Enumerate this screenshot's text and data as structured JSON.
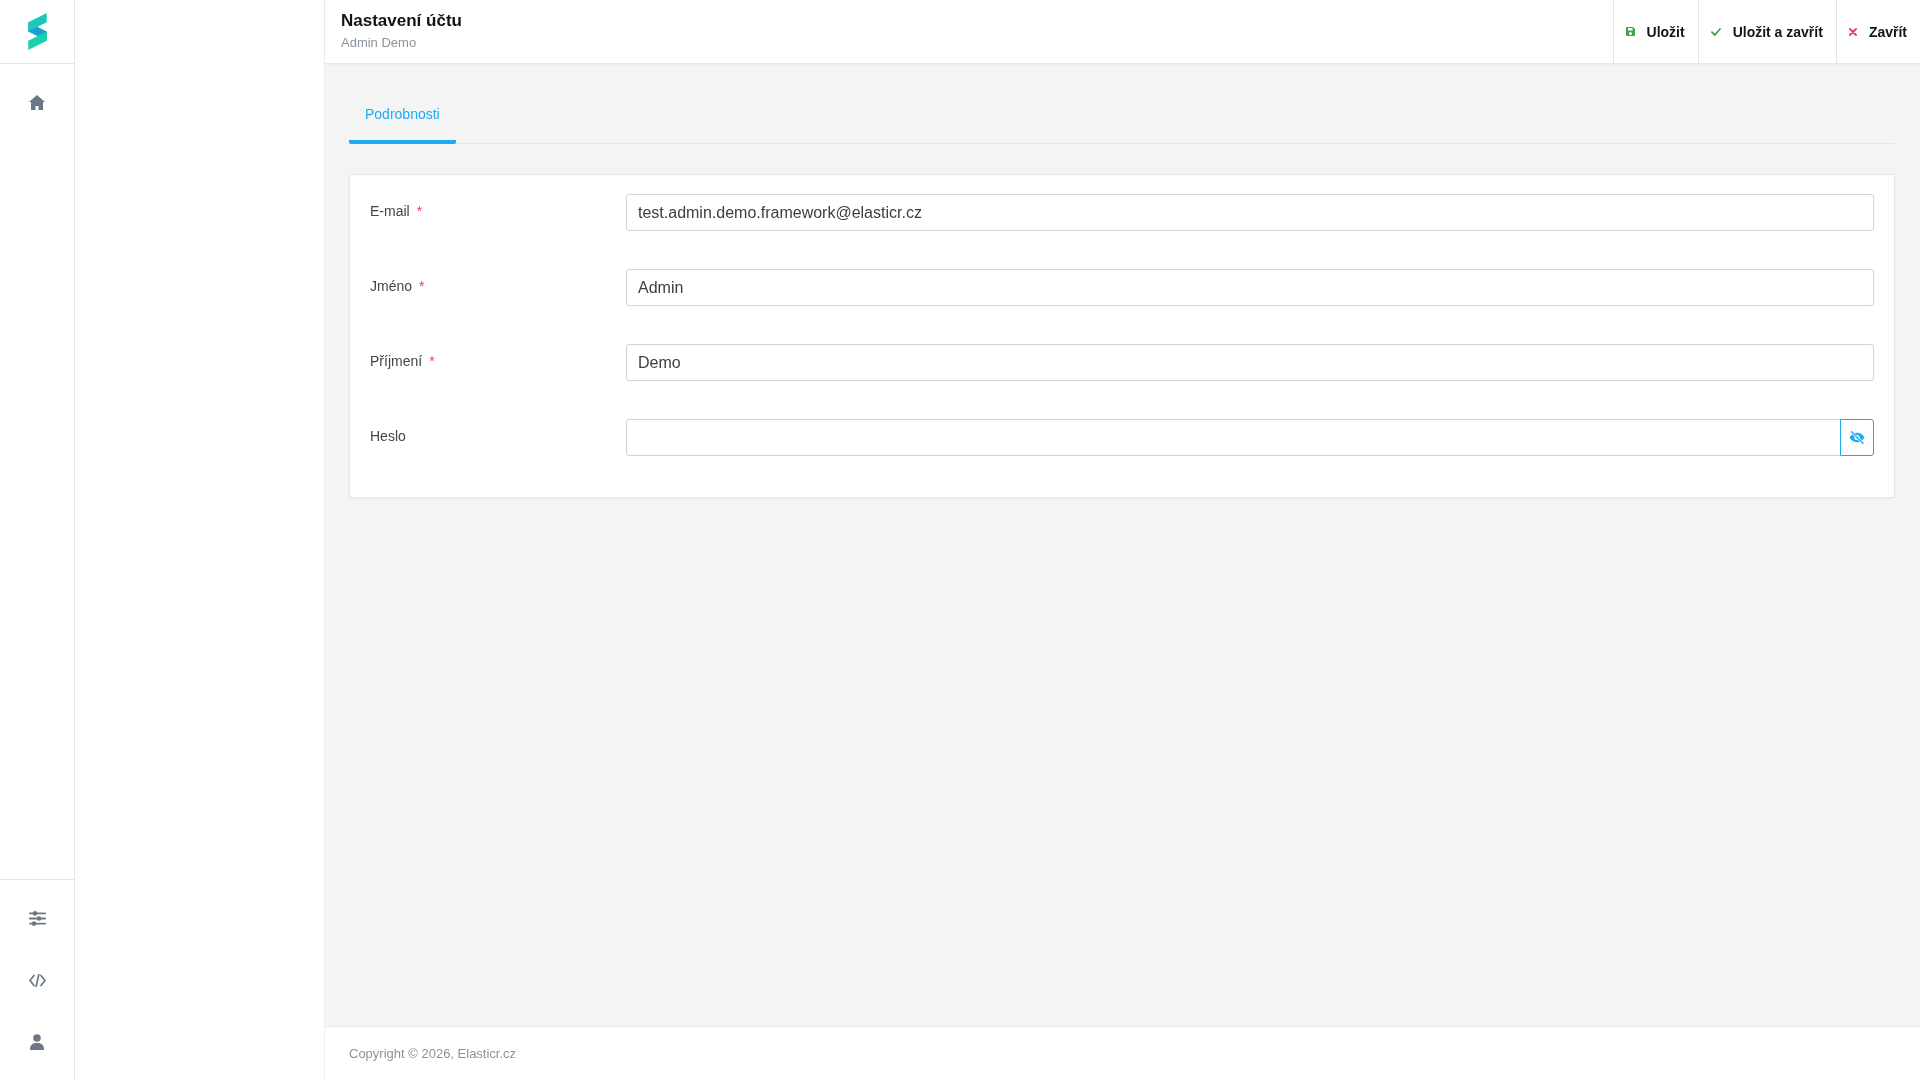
{
  "header": {
    "title": "Nastavení účtu",
    "subtitle": "Admin Demo",
    "actions": [
      {
        "kind": "save",
        "label": "Uložit"
      },
      {
        "kind": "save_close",
        "label": "Uložit a zavřít"
      },
      {
        "kind": "close",
        "label": "Zavřít"
      }
    ]
  },
  "tabs": [
    {
      "label": "Podrobnosti",
      "selected": true
    }
  ],
  "form": {
    "fields": [
      {
        "kind": "text",
        "label": "E-mail",
        "required_mark": "*",
        "value": "test.admin.demo.framework@elasticr.cz"
      },
      {
        "kind": "text",
        "label": "Jméno",
        "required_mark": "*",
        "value": "Admin"
      },
      {
        "kind": "text",
        "label": "Příjmení",
        "required_mark": "*",
        "value": "Demo"
      },
      {
        "kind": "password",
        "label": "Heslo"
      }
    ]
  },
  "footer": {
    "text": "Copyright © 2026, Elasticr.cz"
  }
}
